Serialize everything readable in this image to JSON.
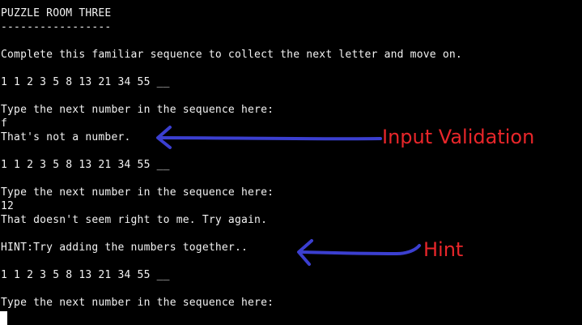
{
  "terminal": {
    "lines": [
      "PUZZLE ROOM THREE",
      "-----------------",
      "",
      "Complete this familiar sequence to collect the next letter and move on.",
      "",
      "1 1 2 3 5 8 13 21 34 55 __",
      "",
      "Type the next number in the sequence here:",
      "f",
      "That's not a number.",
      "",
      "1 1 2 3 5 8 13 21 34 55 __",
      "",
      "Type the next number in the sequence here:",
      "12",
      "That doesn't seem right to me. Try again.",
      "",
      "HINT:Try adding the numbers together..",
      "",
      "1 1 2 3 5 8 13 21 34 55 __",
      "",
      "Type the next number in the sequence here:"
    ],
    "text_color": "#f2f2f2",
    "background": "#000000"
  },
  "annotations": {
    "input_validation": {
      "label": "Input Validation",
      "label_color": "#e8262a",
      "arrow_color": "#3b3fd0"
    },
    "hint": {
      "label": "Hint",
      "label_color": "#e8262a",
      "arrow_color": "#3b3fd0"
    }
  }
}
